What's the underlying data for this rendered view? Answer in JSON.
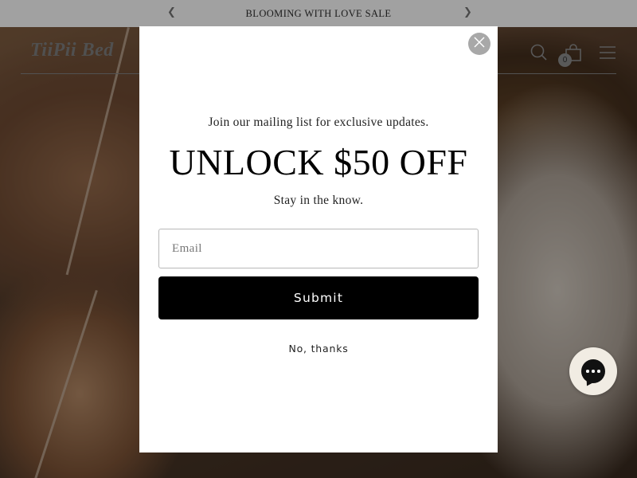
{
  "announcement": {
    "text": "BLOOMING WITH LOVE SALE",
    "prev_icon": "chevron-left-icon",
    "next_icon": "chevron-right-icon"
  },
  "header": {
    "logo_text": "TiiPii Bed",
    "search_icon": "search-icon",
    "cart_icon": "shopping-bag-icon",
    "cart_count": "0",
    "menu_icon": "hamburger-menu-icon"
  },
  "popup": {
    "subtitle": "Join our mailing list for exclusive updates.",
    "headline": "UNLOCK $50 OFF",
    "tagline": "Stay in the know.",
    "email_value": "",
    "email_placeholder": "Email",
    "submit_label": "Submit",
    "decline_label": "No, thanks",
    "close_icon": "close-icon"
  },
  "chat": {
    "icon": "chat-bubble-icon"
  },
  "colors": {
    "announcement_bg": "#a1a1a1",
    "submit_bg": "#000000",
    "overlay": "rgba(0,0,0,0.42)",
    "chat_bg": "#f1ece3"
  }
}
